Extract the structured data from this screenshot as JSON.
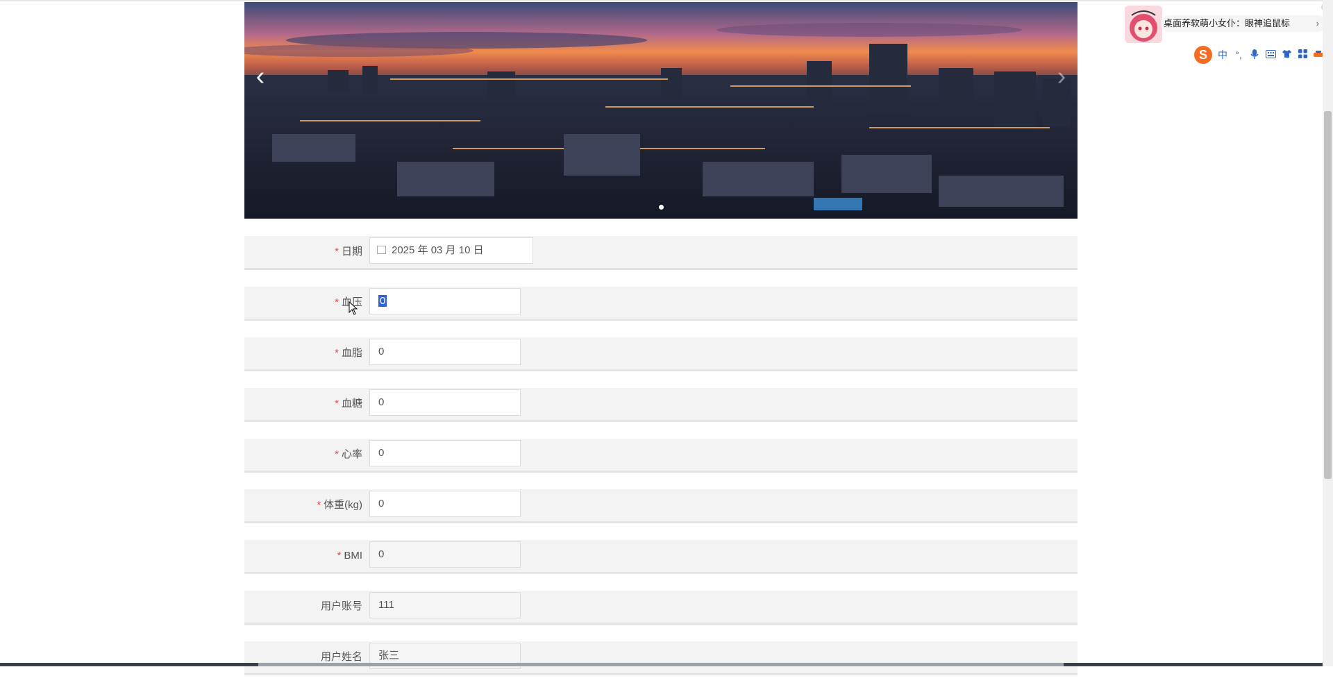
{
  "banner": {
    "prev_glyph": "‹",
    "next_glyph": "›",
    "slide_count": 1,
    "active_slide": 1
  },
  "form": {
    "required_mark": "*",
    "fields": [
      {
        "label": "日期",
        "value": "2025 年 03 月 10 日",
        "required": true,
        "type": "date"
      },
      {
        "label": "血压",
        "value": "0",
        "required": true,
        "type": "text",
        "selected": true
      },
      {
        "label": "血脂",
        "value": "0",
        "required": true,
        "type": "text"
      },
      {
        "label": "血糖",
        "value": "0",
        "required": true,
        "type": "text"
      },
      {
        "label": "心率",
        "value": "0",
        "required": true,
        "type": "text"
      },
      {
        "label": "体重(kg)",
        "value": "0",
        "required": true,
        "type": "text"
      },
      {
        "label": "BMI",
        "value": "0",
        "required": true,
        "type": "readonly"
      },
      {
        "label": "用户账号",
        "value": "111",
        "required": false,
        "type": "readonly"
      },
      {
        "label": "用户姓名",
        "value": "张三",
        "required": false,
        "type": "readonly"
      }
    ]
  },
  "widget": {
    "bubble_text": "桌面养软萌小女仆：眼神追鼠标",
    "chevron": "›",
    "close_glyph": "×"
  },
  "ime_toolbar": {
    "logo": "S",
    "items": [
      "中",
      "°,",
      "mic-icon",
      "keyboard-icon",
      "shirt-icon",
      "apps-icon",
      "tools-icon"
    ],
    "mode_label": "中",
    "punct_label": "°,"
  },
  "colors": {
    "required": "#e84a4a",
    "row_bg": "#f3f3f3",
    "selection": "#2f63d6",
    "ime_accent": "#f36c21"
  }
}
